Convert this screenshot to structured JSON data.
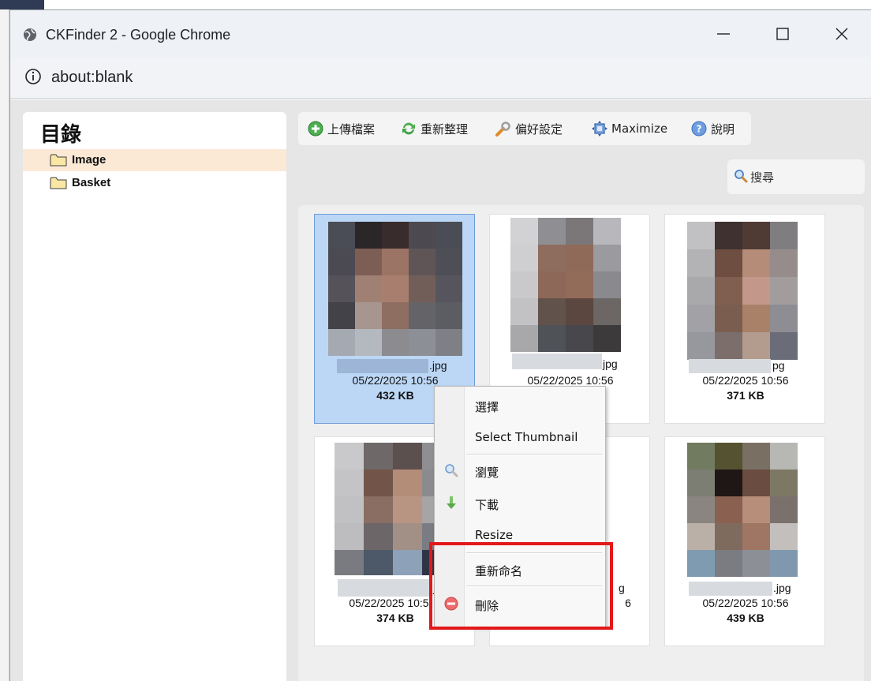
{
  "browser": {
    "window_title": "CKFinder 2 - Google Chrome",
    "url": "about:blank"
  },
  "tree": {
    "title": "目錄",
    "items": [
      {
        "label": "Image",
        "selected": true
      },
      {
        "label": "Basket",
        "selected": false
      }
    ]
  },
  "toolbar": {
    "upload": "上傳檔案",
    "refresh": "重新整理",
    "settings": "偏好設定",
    "maximize": "Maximize",
    "help": "說明"
  },
  "search": {
    "label": "搜尋"
  },
  "files": [
    {
      "ext": ".jpg",
      "date": "05/22/2025 10:56",
      "size": "432 KB",
      "selected": true
    },
    {
      "ext": "jpg",
      "date": "05/22/2025 10:56",
      "size": ""
    },
    {
      "ext": "pg",
      "date": "05/22/2025 10:56",
      "size": "371 KB"
    },
    {
      "ext": "jp",
      "date": "05/22/2025 10:5",
      "size": "374 KB"
    },
    {
      "ext": "g",
      "date": "6",
      "size": ""
    },
    {
      "ext": ".jpg",
      "date": "05/22/2025 10:56",
      "size": "439 KB"
    }
  ],
  "context_menu": {
    "items": [
      {
        "label": "選擇",
        "icon": ""
      },
      {
        "label": "Select Thumbnail",
        "icon": ""
      },
      {
        "label": "瀏覽",
        "icon": "magnifier-icon"
      },
      {
        "label": "下載",
        "icon": "download-arrow-icon"
      },
      {
        "label": "Resize",
        "icon": ""
      },
      {
        "label": "重新命名",
        "icon": ""
      },
      {
        "label": "刪除",
        "icon": "delete-icon"
      }
    ]
  },
  "colors": {
    "highlight": "#e3181a",
    "selected_file": "#bcd7f6",
    "selected_folder": "#fbe9d6"
  }
}
